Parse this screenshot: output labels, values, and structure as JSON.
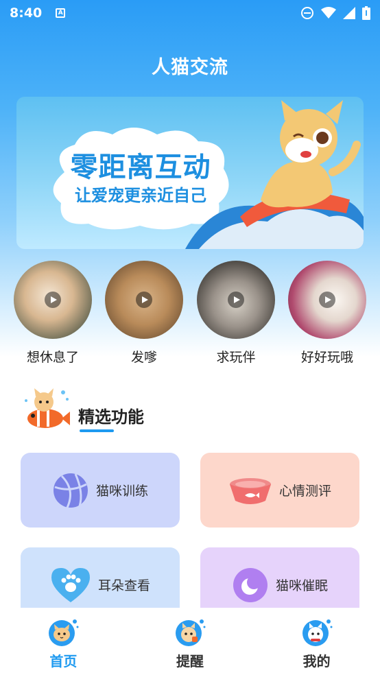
{
  "status_bar": {
    "time": "8:40",
    "notification_icon": "a-icon",
    "icons": [
      "dnd-icon",
      "wifi-icon",
      "signal-icon",
      "battery-icon"
    ]
  },
  "header": {
    "title": "人猫交流"
  },
  "banner": {
    "title": "零距离互动",
    "subtitle": "让爱宠更亲近自己"
  },
  "videos": [
    {
      "label": "想休息了"
    },
    {
      "label": "发嗲"
    },
    {
      "label": "求玩伴"
    },
    {
      "label": "好好玩哦"
    }
  ],
  "section": {
    "title": "精选功能"
  },
  "features": [
    {
      "label": "猫咪训练",
      "icon": "ball-icon",
      "bg": "#cdd6fb"
    },
    {
      "label": "心情测评",
      "icon": "bowl-icon",
      "bg": "#fdd7cb"
    },
    {
      "label": "耳朵查看",
      "icon": "paw-heart-icon",
      "bg": "#cfe2fc"
    },
    {
      "label": "猫咪催眠",
      "icon": "moon-icon",
      "bg": "#e6d3fb"
    }
  ],
  "tabs": [
    {
      "label": "首页",
      "active": true
    },
    {
      "label": "提醒",
      "active": false
    },
    {
      "label": "我的",
      "active": false
    }
  ],
  "colors": {
    "accent": "#1e9af0"
  }
}
